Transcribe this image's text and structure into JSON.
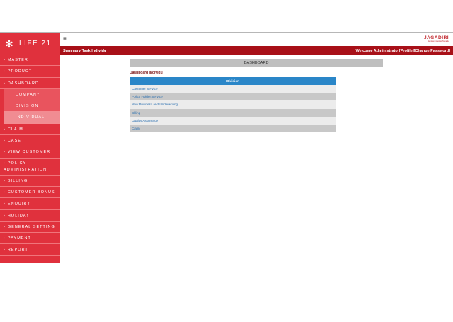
{
  "app": {
    "logo_text": "LIFE 21",
    "brand_name": "JAGADIRI",
    "brand_sub": "Jaminan Investasi Terpadu"
  },
  "sidebar": {
    "items": [
      {
        "label": "MASTER"
      },
      {
        "label": "PRODUCT"
      },
      {
        "label": "DASHBOARD"
      }
    ],
    "dashboard_sub": [
      {
        "label": "COMPANY"
      },
      {
        "label": "DIVISION"
      },
      {
        "label": "INDIVIDUAL"
      }
    ],
    "items_after": [
      {
        "label": "CLAIM"
      },
      {
        "label": "CASE"
      },
      {
        "label": "VIEW CUSTOMER"
      },
      {
        "label": "POLICY ADMINISTRATION"
      },
      {
        "label": "BILLING"
      },
      {
        "label": "CUSTOMER BONUS"
      },
      {
        "label": "ENQUIRY"
      },
      {
        "label": "HOLIDAY"
      },
      {
        "label": "GENERAL SETTING"
      },
      {
        "label": "PAYMENT"
      },
      {
        "label": "REPORT"
      }
    ]
  },
  "header": {
    "breadcrumb": "Summary Task Individu",
    "welcome": "Welcome Administrator",
    "profile_link": "[Profile]",
    "change_password_link": "[Change Password]"
  },
  "main": {
    "title": "DASHBOARD",
    "section_title": "Dashboard Individu",
    "table": {
      "header": "Division",
      "rows": [
        "Customer Service",
        "Policy Holder Service",
        "New Business and Underwriting",
        "Billing",
        "Quality Assurance",
        "Claim"
      ]
    }
  },
  "colors": {
    "sidebar": "#e0313d",
    "header_bar": "#a81018",
    "table_header": "#2a86c8"
  }
}
